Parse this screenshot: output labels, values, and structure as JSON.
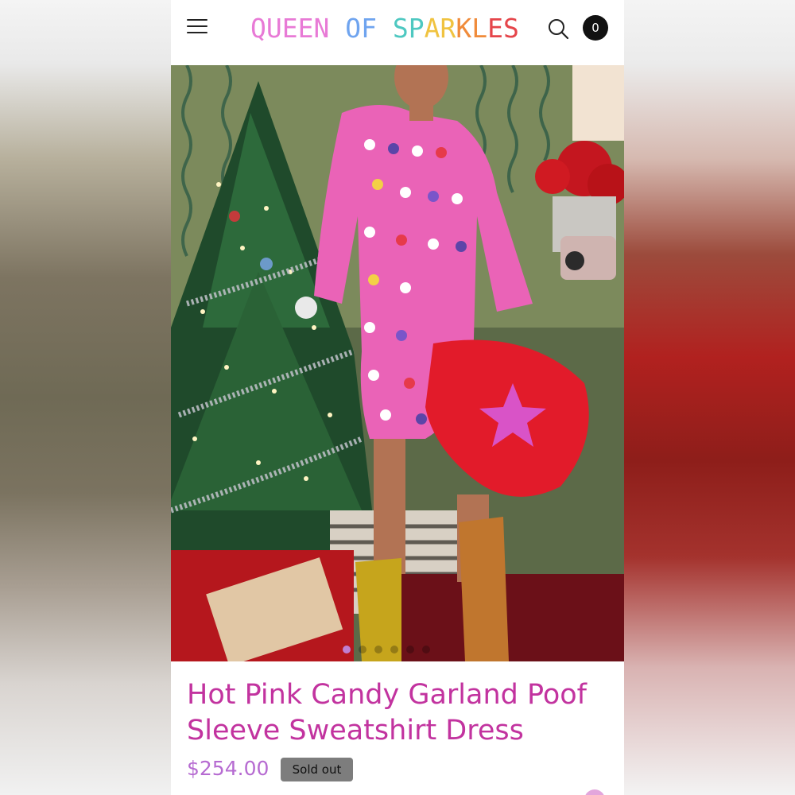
{
  "header": {
    "logo_text": "QUEEN OF SPARKLES",
    "logo_parts": [
      "QUEEN",
      " ",
      "OF",
      " ",
      "SP",
      "AR",
      "KL",
      "ES"
    ],
    "cart_count": "0"
  },
  "icons": {
    "menu": "hamburger-menu-icon",
    "search": "search-icon",
    "cart": "cart-count-badge"
  },
  "product": {
    "title": "Hot Pink Candy Garland Poof Sleeve Sweatshirt Dress",
    "price": "$254.00",
    "status_badge": "Sold out",
    "image_alt": "Model wearing hot pink candy garland sweatshirt dress beside a Christmas tree"
  },
  "carousel": {
    "slide_count": 6,
    "active_index": 0
  },
  "colors": {
    "title": "#c2339f",
    "price": "#b66bd1",
    "badge_bg": "#7d7d7d",
    "accent_pink": "#e24fa8"
  }
}
